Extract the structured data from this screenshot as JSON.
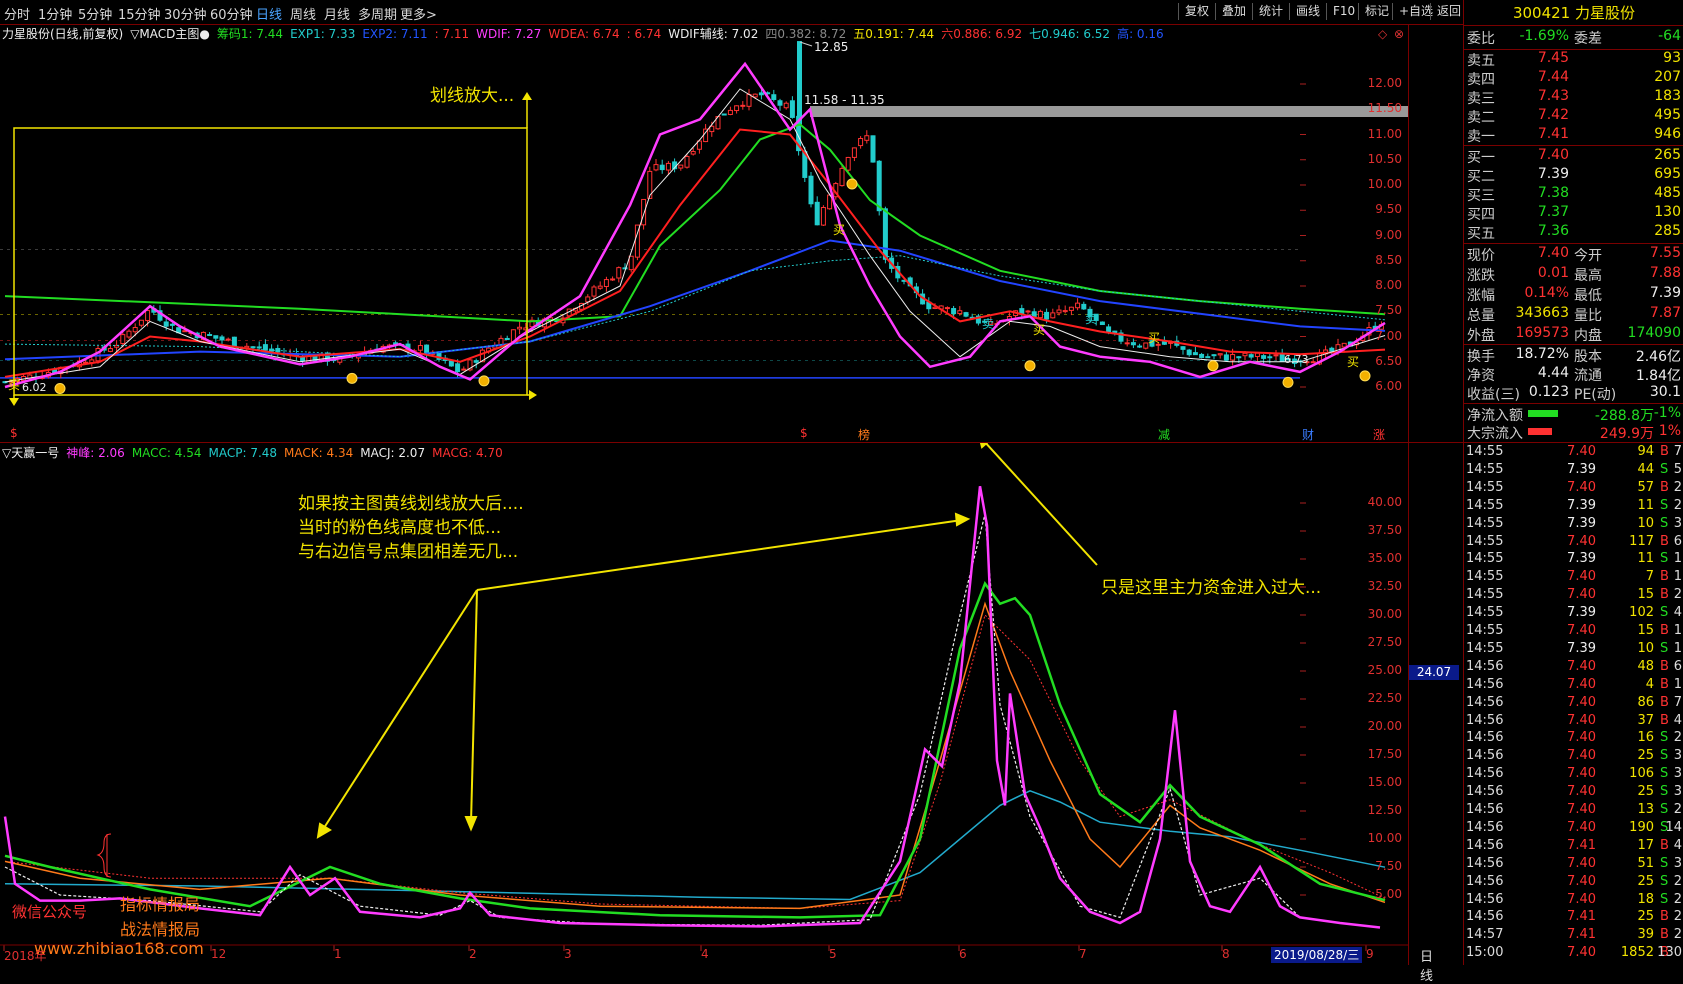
{
  "toolbar": {
    "periods": [
      "分时",
      "1分钟",
      "5分钟",
      "15分钟",
      "30分钟",
      "60分钟",
      "日线",
      "周线",
      "月线",
      "多周期",
      "更多>"
    ],
    "active": "日线",
    "buttons": [
      "复权",
      "叠加",
      "统计",
      "画线",
      "F10",
      "标记",
      "+自选",
      "返回"
    ]
  },
  "main": {
    "title": "力星股份(日线,前复权)",
    "indicator": "▽MACD主图●",
    "legend": [
      {
        "text": "筹码1: 7.44",
        "color": "#22dd22"
      },
      {
        "text": "EXP1: 7.33",
        "color": "#22cccc"
      },
      {
        "text": "EXP2: 7.11",
        "color": "#2255ff"
      },
      {
        "text": ": 7.11",
        "color": "#ff3232"
      },
      {
        "text": "WDIF: 7.27",
        "color": "#ff3cff"
      },
      {
        "text": "WDEA: 6.74",
        "color": "#ff3232"
      },
      {
        "text": ": 6.74",
        "color": "#ff3232"
      },
      {
        "text": "WDIF辅线: 7.02",
        "color": "#eeeeee"
      },
      {
        "text": "四0.382: 8.72",
        "color": "#888888"
      },
      {
        "text": "五0.191: 7.44",
        "color": "#f2e400"
      },
      {
        "text": "六0.886: 6.92",
        "color": "#ff3232"
      },
      {
        "text": "七0.946: 6.52",
        "color": "#22cccc"
      },
      {
        "text": "高: 0.16",
        "color": "#2255ff"
      }
    ],
    "y_ticks": [
      "12.00",
      "11.50",
      "11.00",
      "10.50",
      "10.00",
      "9.50",
      "9.00",
      "8.50",
      "8.00",
      "7.50",
      "7.00",
      "6.50",
      "6.00"
    ],
    "annotations": {
      "high": "12.85",
      "zone": "11.58 - 11.35",
      "low": "6.02",
      "last": "6.73"
    },
    "markers": [
      "买",
      "买",
      "买",
      "买",
      "买",
      "卖",
      "卖"
    ],
    "bottom_labels": [
      "$",
      "$",
      "榜",
      "减",
      "财",
      "涨"
    ],
    "note": "划线放大..."
  },
  "sub": {
    "title": "▽天赢一号",
    "legend": [
      {
        "text": "神峰: 2.06",
        "color": "#ff3cff"
      },
      {
        "text": "MACC: 4.54",
        "color": "#22dd22"
      },
      {
        "text": "MACP: 7.48",
        "color": "#22cccc"
      },
      {
        "text": "MACK: 4.34",
        "color": "#ff7a1a"
      },
      {
        "text": "MACJ: 2.07",
        "color": "#eeeeee"
      },
      {
        "text": "MACG: 4.70",
        "color": "#ff3232"
      }
    ],
    "y_ticks": [
      "40.00",
      "37.50",
      "35.00",
      "32.50",
      "30.00",
      "27.50",
      "25.00",
      "22.50",
      "20.00",
      "17.50",
      "15.00",
      "12.50",
      "10.00",
      "7.50",
      "5.00"
    ],
    "cursor_value": "24.07",
    "note1": "如果按主图黄线划线放大后....",
    "note2": "当时的粉色线高度也不低...",
    "note3": "与右边信号点集团相差无几...",
    "note4": "只是这里主力资金进入过大...",
    "watermark1": "微信公众号",
    "watermark2": "指标情报局",
    "watermark3": "战法情报局",
    "watermark_url": "www.zhibiao168.com",
    "x_labels": [
      "2018年",
      "12",
      "1",
      "2",
      "3",
      "4",
      "5",
      "6",
      "7",
      "8",
      "9"
    ],
    "date_label": "2019/08/28/三",
    "period_label": "日线"
  },
  "quote": {
    "code": "300421",
    "name": "力星股份",
    "weibi_label": "委比",
    "weibi": "-1.69%",
    "weicha_label": "委差",
    "weicha": "-64",
    "sells": [
      {
        "label": "卖五",
        "price": "7.45",
        "vol": "93"
      },
      {
        "label": "卖四",
        "price": "7.44",
        "vol": "207"
      },
      {
        "label": "卖三",
        "price": "7.43",
        "vol": "183"
      },
      {
        "label": "卖二",
        "price": "7.42",
        "vol": "495"
      },
      {
        "label": "卖一",
        "price": "7.41",
        "vol": "946"
      }
    ],
    "buys": [
      {
        "label": "买一",
        "price": "7.40",
        "vol": "265"
      },
      {
        "label": "买二",
        "price": "7.39",
        "vol": "695"
      },
      {
        "label": "买三",
        "price": "7.38",
        "vol": "485"
      },
      {
        "label": "买四",
        "price": "7.37",
        "vol": "130"
      },
      {
        "label": "买五",
        "price": "7.36",
        "vol": "285"
      }
    ],
    "stats": [
      {
        "l1": "现价",
        "v1": "7.40",
        "c1": "#ff3232",
        "l2": "今开",
        "v2": "7.55",
        "c2": "#ff3232"
      },
      {
        "l1": "涨跌",
        "v1": "0.01",
        "c1": "#ff3232",
        "l2": "最高",
        "v2": "7.88",
        "c2": "#ff3232"
      },
      {
        "l1": "涨幅",
        "v1": "0.14%",
        "c1": "#ff3232",
        "l2": "最低",
        "v2": "7.39",
        "c2": "#eeeeee"
      },
      {
        "l1": "总量",
        "v1": "343663",
        "c1": "#f2e400",
        "l2": "量比",
        "v2": "7.87",
        "c2": "#ff3232"
      },
      {
        "l1": "外盘",
        "v1": "169573",
        "c1": "#ff3232",
        "l2": "内盘",
        "v2": "174090",
        "c2": "#22dd22"
      }
    ],
    "stats2": [
      {
        "l1": "换手",
        "v1": "18.72%",
        "c1": "#eeeeee",
        "l2": "股本",
        "v2": "2.46亿",
        "c2": "#eeeeee"
      },
      {
        "l1": "净资",
        "v1": "4.44",
        "c1": "#eeeeee",
        "l2": "流通",
        "v2": "1.84亿",
        "c2": "#eeeeee"
      },
      {
        "l1": "收益(三)",
        "v1": "0.123",
        "c1": "#eeeeee",
        "l2": "PE(动)",
        "v2": "30.1",
        "c2": "#eeeeee"
      }
    ],
    "flow": [
      {
        "label": "净流入额",
        "value": "-288.8万",
        "pct": "-1%",
        "color": "#22dd22",
        "bar": 0.75
      },
      {
        "label": "大宗流入",
        "value": "249.9万",
        "pct": "1%",
        "color": "#ff3232",
        "bar": 0.6
      }
    ],
    "ticks": [
      {
        "t": "14:55",
        "p": "7.40",
        "v": "94",
        "bs": "B",
        "n": "7"
      },
      {
        "t": "14:55",
        "p": "7.39",
        "v": "44",
        "bs": "S",
        "n": "5"
      },
      {
        "t": "14:55",
        "p": "7.40",
        "v": "57",
        "bs": "B",
        "n": "2"
      },
      {
        "t": "14:55",
        "p": "7.39",
        "v": "11",
        "bs": "S",
        "n": "2"
      },
      {
        "t": "14:55",
        "p": "7.39",
        "v": "10",
        "bs": "S",
        "n": "3"
      },
      {
        "t": "14:55",
        "p": "7.40",
        "v": "117",
        "bs": "B",
        "n": "6"
      },
      {
        "t": "14:55",
        "p": "7.39",
        "v": "11",
        "bs": "S",
        "n": "1"
      },
      {
        "t": "14:55",
        "p": "7.40",
        "v": "7",
        "bs": "B",
        "n": "1"
      },
      {
        "t": "14:55",
        "p": "7.40",
        "v": "15",
        "bs": "B",
        "n": "2"
      },
      {
        "t": "14:55",
        "p": "7.39",
        "v": "102",
        "bs": "S",
        "n": "4"
      },
      {
        "t": "14:55",
        "p": "7.40",
        "v": "15",
        "bs": "B",
        "n": "1"
      },
      {
        "t": "14:55",
        "p": "7.39",
        "v": "10",
        "bs": "S",
        "n": "1"
      },
      {
        "t": "14:56",
        "p": "7.40",
        "v": "48",
        "bs": "B",
        "n": "6"
      },
      {
        "t": "14:56",
        "p": "7.40",
        "v": "4",
        "bs": "B",
        "n": "1"
      },
      {
        "t": "14:56",
        "p": "7.40",
        "v": "86",
        "bs": "B",
        "n": "7"
      },
      {
        "t": "14:56",
        "p": "7.40",
        "v": "37",
        "bs": "B",
        "n": "4"
      },
      {
        "t": "14:56",
        "p": "7.40",
        "v": "16",
        "bs": "S",
        "n": "2"
      },
      {
        "t": "14:56",
        "p": "7.40",
        "v": "25",
        "bs": "S",
        "n": "3"
      },
      {
        "t": "14:56",
        "p": "7.40",
        "v": "106",
        "bs": "S",
        "n": "3"
      },
      {
        "t": "14:56",
        "p": "7.40",
        "v": "25",
        "bs": "S",
        "n": "3"
      },
      {
        "t": "14:56",
        "p": "7.40",
        "v": "13",
        "bs": "S",
        "n": "2"
      },
      {
        "t": "14:56",
        "p": "7.40",
        "v": "190",
        "bs": "S",
        "n": "14"
      },
      {
        "t": "14:56",
        "p": "7.41",
        "v": "17",
        "bs": "B",
        "n": "4"
      },
      {
        "t": "14:56",
        "p": "7.40",
        "v": "51",
        "bs": "S",
        "n": "3"
      },
      {
        "t": "14:56",
        "p": "7.40",
        "v": "25",
        "bs": "S",
        "n": "2"
      },
      {
        "t": "14:56",
        "p": "7.40",
        "v": "18",
        "bs": "S",
        "n": "2"
      },
      {
        "t": "14:56",
        "p": "7.41",
        "v": "25",
        "bs": "B",
        "n": "2"
      },
      {
        "t": "14:57",
        "p": "7.41",
        "v": "39",
        "bs": "B",
        "n": "2"
      },
      {
        "t": "15:00",
        "p": "7.40",
        "v": "1852",
        "bs": "B",
        "n": "130"
      }
    ]
  }
}
